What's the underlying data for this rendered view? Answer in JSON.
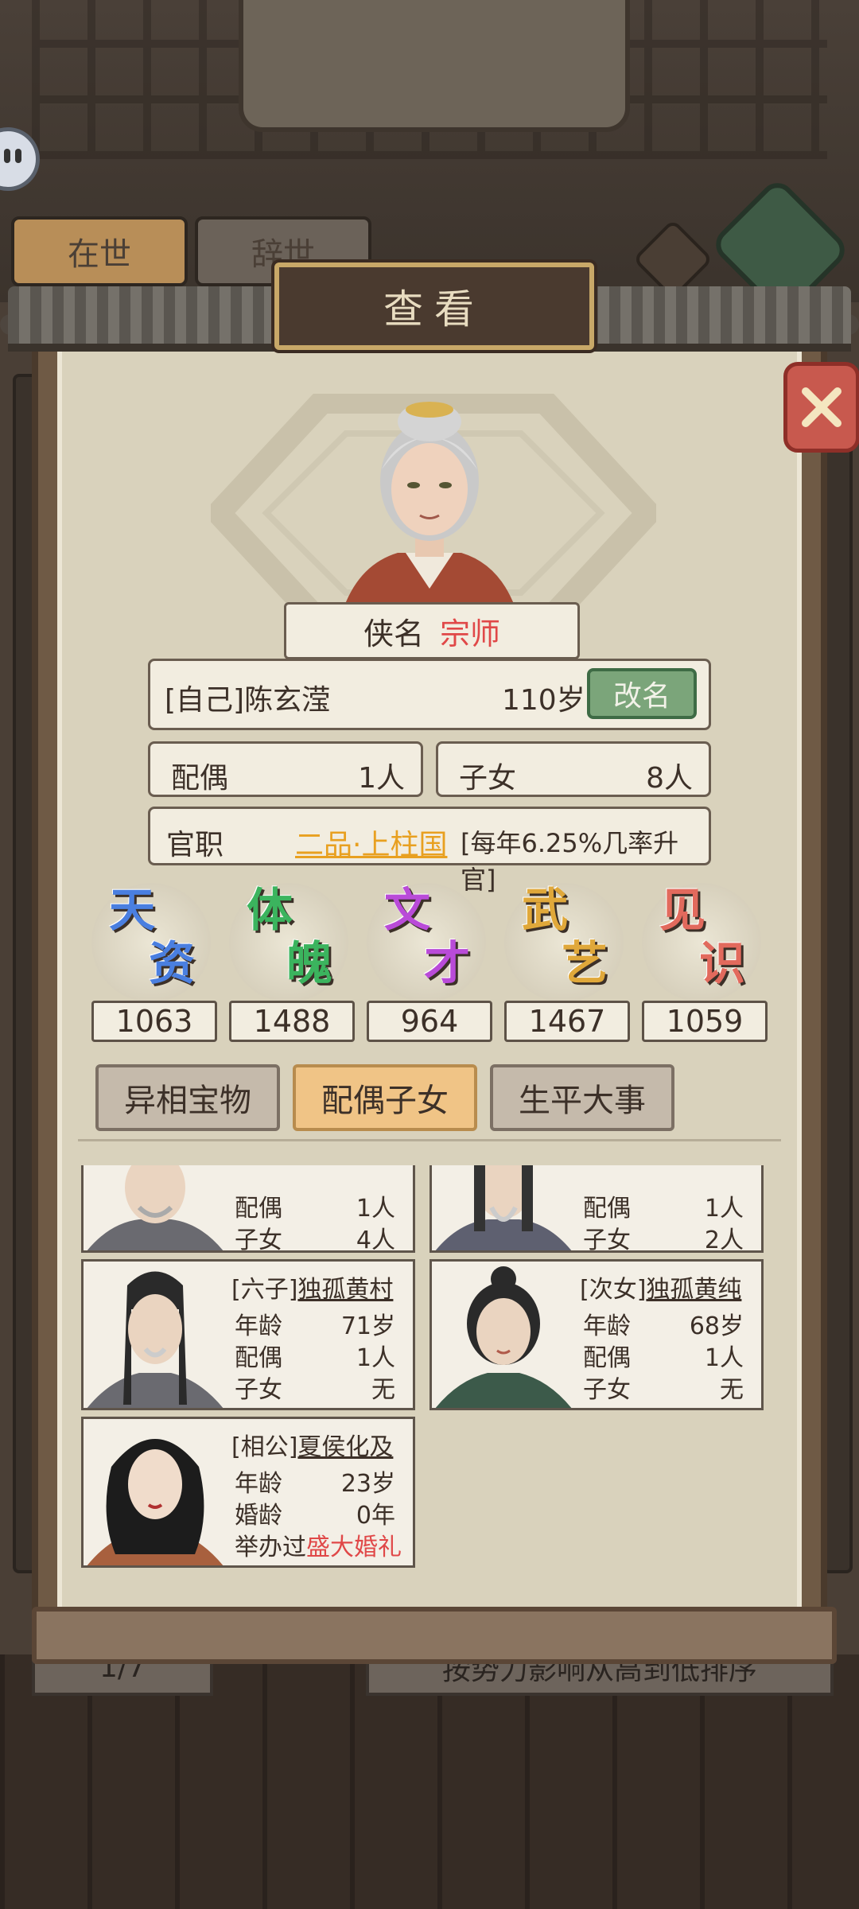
{
  "colors": {
    "accent_red": "#e04848",
    "rank_yellow": "#e8a020",
    "rename_green": "#7ba57a"
  },
  "background": {
    "tabs": [
      "在世",
      "辞世"
    ],
    "page_indicator": "1/7",
    "sort_label": "按势力影响从高到低排序"
  },
  "modal": {
    "title": "查看",
    "title_label": "侠名",
    "title_value": "宗师",
    "identity": "[自己]陈玄滢",
    "age": "110岁",
    "rename_label": "改名",
    "spouse_label": "配偶",
    "spouse_value": "1人",
    "children_label": "子女",
    "children_value": "8人",
    "office_label": "官职",
    "office_value": "二品·上柱国",
    "office_note": "[每年6.25%几率升官]",
    "stats": [
      {
        "label_a": "天",
        "label_b": "资",
        "value": "1063",
        "color": "#4a7fe0"
      },
      {
        "label_a": "体",
        "label_b": "魄",
        "value": "1488",
        "color": "#3bb45e"
      },
      {
        "label_a": "文",
        "label_b": "才",
        "value": "964",
        "color": "#b94bd8"
      },
      {
        "label_a": "武",
        "label_b": "艺",
        "value": "1467",
        "color": "#e0a83a"
      },
      {
        "label_a": "见",
        "label_b": "识",
        "value": "1059",
        "color": "#e26a5d"
      }
    ],
    "tabs": [
      "异相宝物",
      "配偶子女",
      "生平大事"
    ],
    "cards": [
      {
        "name": "",
        "rows": [
          [
            "配偶",
            "1人"
          ],
          [
            "子女",
            "4人"
          ]
        ]
      },
      {
        "name": "",
        "rows": [
          [
            "配偶",
            "1人"
          ],
          [
            "子女",
            "2人"
          ]
        ]
      },
      {
        "prefix": "[六子]",
        "name": "独孤黄村",
        "rows": [
          [
            "年龄",
            "71岁"
          ],
          [
            "配偶",
            "1人"
          ],
          [
            "子女",
            "无"
          ]
        ]
      },
      {
        "prefix": "[次女]",
        "name": "独孤黄纯",
        "rows": [
          [
            "年龄",
            "68岁"
          ],
          [
            "配偶",
            "1人"
          ],
          [
            "子女",
            "无"
          ]
        ]
      },
      {
        "prefix": "[相公]",
        "name": "夏侯化及",
        "rows": [
          [
            "年龄",
            "23岁"
          ],
          [
            "婚龄",
            "0年"
          ]
        ],
        "wedding_label": "举办过",
        "wedding_value": "盛大婚礼"
      }
    ]
  }
}
